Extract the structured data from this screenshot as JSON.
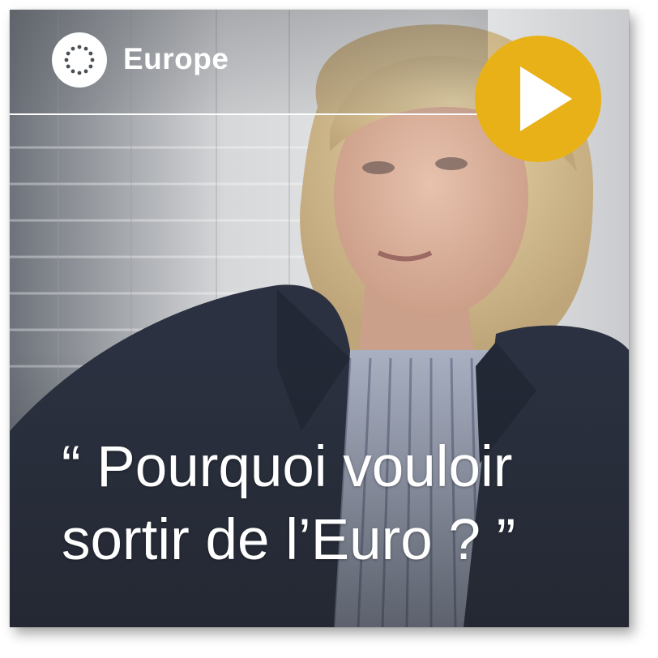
{
  "card": {
    "section_label": "Europe",
    "section_icon": "eu-stars-icon",
    "quote_line_1": "“ Pourquoi vouloir",
    "quote_line_2": "sortir de l’Euro ? ”",
    "play_icon": "play-icon"
  },
  "colors": {
    "play_button": "#e8b118",
    "text": "#ffffff",
    "badge": "#ffffff",
    "eu_stars": "#4a4f57"
  }
}
